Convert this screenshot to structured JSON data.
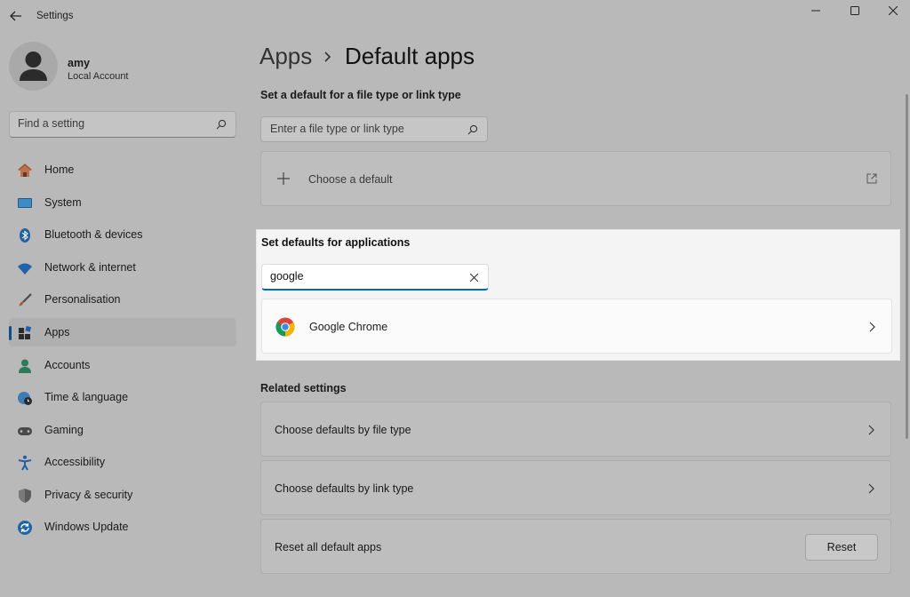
{
  "window": {
    "title": "Settings",
    "controls": {
      "minimize": "minimize-icon",
      "maximize": "maximize-icon",
      "close": "close-icon"
    }
  },
  "user": {
    "name": "amy",
    "account_type": "Local Account"
  },
  "sidebar": {
    "search_placeholder": "Find a setting",
    "items": [
      {
        "label": "Home",
        "icon": "home-icon"
      },
      {
        "label": "System",
        "icon": "monitor-icon"
      },
      {
        "label": "Bluetooth & devices",
        "icon": "bluetooth-icon"
      },
      {
        "label": "Network & internet",
        "icon": "wifi-icon"
      },
      {
        "label": "Personalisation",
        "icon": "paintbrush-icon"
      },
      {
        "label": "Apps",
        "icon": "apps-icon",
        "active": true
      },
      {
        "label": "Accounts",
        "icon": "person-icon"
      },
      {
        "label": "Time & language",
        "icon": "globe-clock-icon"
      },
      {
        "label": "Gaming",
        "icon": "gamepad-icon"
      },
      {
        "label": "Accessibility",
        "icon": "accessibility-icon"
      },
      {
        "label": "Privacy & security",
        "icon": "shield-icon"
      },
      {
        "label": "Windows Update",
        "icon": "update-icon"
      }
    ]
  },
  "main": {
    "breadcrumb": {
      "parent": "Apps",
      "current": "Default apps"
    },
    "file_type_section": {
      "heading": "Set a default for a file type or link type",
      "search_placeholder": "Enter a file type or link type",
      "choose_default_label": "Choose a default"
    },
    "app_defaults_section": {
      "heading": "Set defaults for applications",
      "search_value": "google",
      "results": [
        {
          "name": "Google Chrome",
          "icon": "chrome-icon"
        }
      ]
    },
    "related_settings": {
      "heading": "Related settings",
      "items": [
        {
          "label": "Choose defaults by file type"
        },
        {
          "label": "Choose defaults by link type"
        },
        {
          "label": "Reset all default apps",
          "button_label": "Reset"
        }
      ]
    }
  },
  "colors": {
    "accent": "#0067c0",
    "dim_background": "#b9b9b9",
    "highlight_panel": "#f4f4f4"
  }
}
